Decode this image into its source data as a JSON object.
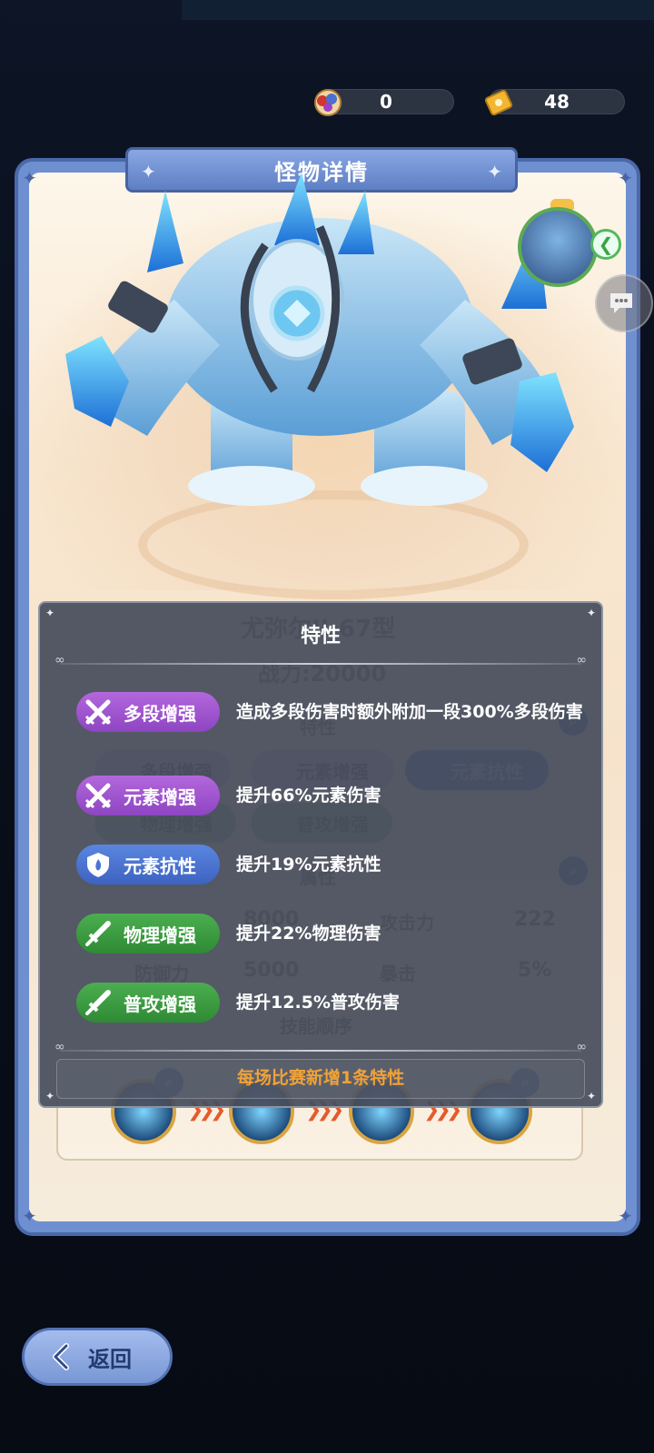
{
  "currency": {
    "gems": "0",
    "tickets": "48"
  },
  "panel": {
    "title": "怪物详情"
  },
  "background": {
    "monster_name": "尤弥尔II-67型",
    "power": "战力:20000",
    "traits_heading": "特性",
    "trait_chips": [
      "多段增强",
      "元素增强",
      "元素抗性",
      "物理增强",
      "普攻增强"
    ],
    "attributes_heading": "属性",
    "hp_value": "8000",
    "attack_label": "攻击力",
    "attack_value": "222",
    "defense_label": "防御力",
    "defense_value": "5000",
    "crit_label": "暴击",
    "crit_value": "5%",
    "skill_order_heading": "技能顺序"
  },
  "dialog": {
    "title": "特性",
    "traits": [
      {
        "name": "多段增强",
        "desc": "造成多段伤害时额外附加一段300%多段伤害",
        "color": "#a557d4",
        "icon": "crossed-swords-icon"
      },
      {
        "name": "元素增强",
        "desc": "提升66%元素伤害",
        "color": "#a557d4",
        "icon": "crossed-swords-icon"
      },
      {
        "name": "元素抗性",
        "desc": "提升19%元素抗性",
        "color": "#4a74d2",
        "icon": "flame-shield-icon"
      },
      {
        "name": "物理增强",
        "desc": "提升22%物理伤害",
        "color": "#3f9d44",
        "icon": "sword-icon"
      },
      {
        "name": "普攻增强",
        "desc": "提升12.5%普攻伤害",
        "color": "#3f9d44",
        "icon": "sword-icon"
      }
    ],
    "footer": "每场比赛新增1条特性"
  },
  "back_button": {
    "label": "返回"
  }
}
